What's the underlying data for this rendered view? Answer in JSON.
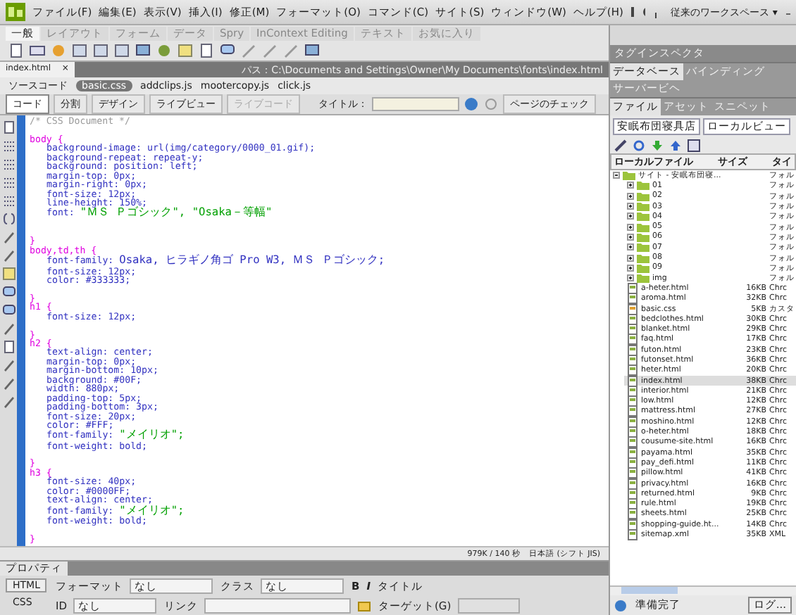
{
  "menu_bar": {
    "items": [
      "ファイル(F)",
      "編集(E)",
      "表示(V)",
      "挿入(I)",
      "修正(M)",
      "フォーマット(O)",
      "コマンド(C)",
      "サイト(S)",
      "ウィンドウ(W)",
      "ヘルプ(H)"
    ],
    "workspace": "従来のワークスペース",
    "workspace_caret": "▾"
  },
  "insert_bar": {
    "tabs": [
      {
        "label": "一般",
        "selected": true
      },
      {
        "label": "レイアウト",
        "selected": false
      },
      {
        "label": "フォーム",
        "selected": false
      },
      {
        "label": "データ",
        "selected": false
      },
      {
        "label": "Spry",
        "selected": false
      },
      {
        "label": "InContext Editing",
        "selected": false
      },
      {
        "label": "テキスト",
        "selected": false
      },
      {
        "label": "お気に入り",
        "selected": false
      }
    ]
  },
  "document_tab": {
    "label": "index.html",
    "close": "×",
    "path": "パス：C:\\Documents and Settings\\Owner\\My Documents\\fonts\\index.html"
  },
  "related_files": [
    {
      "label": "ソースコード",
      "selected": false
    },
    {
      "label": "basic.css",
      "selected": true
    },
    {
      "label": "addclips.js",
      "selected": false
    },
    {
      "label": "mootercopy.js",
      "selected": false
    },
    {
      "label": "click.js",
      "selected": false
    }
  ],
  "doc_toolbar": {
    "views": [
      {
        "label": "コード",
        "selected": true
      },
      {
        "label": "分割",
        "selected": false
      },
      {
        "label": "デザイン",
        "selected": false
      }
    ],
    "live_view": "ライブビュー",
    "live_code": "ライブコード",
    "title_label": "タイトル：",
    "check_page": "ページのチェック"
  },
  "code_lines": [
    {
      "kind": "comment",
      "text": "/* CSS Document */"
    },
    {
      "kind": "blank"
    },
    {
      "kind": "selector",
      "text": "body {"
    },
    {
      "kind": "decl",
      "prop": "background-image:",
      "value": "url(img/category/0000_01.gif);"
    },
    {
      "kind": "decl",
      "prop": "background-repeat:",
      "value": "repeat-y;"
    },
    {
      "kind": "decl",
      "prop": "background:",
      "value": "position: left;"
    },
    {
      "kind": "decl",
      "prop": "margin-top:",
      "value": "0px;"
    },
    {
      "kind": "decl",
      "prop": "margin-right:",
      "value": "0px;"
    },
    {
      "kind": "decl",
      "prop": "font-size:",
      "value": "12px;"
    },
    {
      "kind": "decl",
      "prop": "line-height:",
      "value": "150%;"
    },
    {
      "kind": "string",
      "prop": "font:",
      "value": "\"ＭＳ Ｐゴシック\", \"Osaka－等幅\""
    },
    {
      "kind": "blank"
    },
    {
      "kind": "blank"
    },
    {
      "kind": "selector",
      "text": "}"
    },
    {
      "kind": "selector",
      "text": "body,td,th {"
    },
    {
      "kind": "decl",
      "prop": "font-family:",
      "value": "Osaka, ヒラギノ角ゴ Pro W3, ＭＳ Ｐゴシック;"
    },
    {
      "kind": "decl",
      "prop": "font-size:",
      "value": "12px;"
    },
    {
      "kind": "decl",
      "prop": "color:",
      "value": "#333333;"
    },
    {
      "kind": "blank"
    },
    {
      "kind": "selector",
      "text": "}"
    },
    {
      "kind": "selector",
      "text": "h1 {"
    },
    {
      "kind": "decl",
      "prop": "font-size:",
      "value": "12px;"
    },
    {
      "kind": "blank"
    },
    {
      "kind": "selector",
      "text": "}"
    },
    {
      "kind": "selector",
      "text": "h2 {"
    },
    {
      "kind": "decl",
      "prop": "text-align:",
      "value": "center;"
    },
    {
      "kind": "decl",
      "prop": "margin-top:",
      "value": "0px;"
    },
    {
      "kind": "decl",
      "prop": "margin-bottom:",
      "value": "10px;"
    },
    {
      "kind": "decl",
      "prop": "background:",
      "value": "#00F;"
    },
    {
      "kind": "decl",
      "prop": "width:",
      "value": "880px;"
    },
    {
      "kind": "decl",
      "prop": "padding-top:",
      "value": "5px;"
    },
    {
      "kind": "decl",
      "prop": "padding-bottom:",
      "value": "3px;"
    },
    {
      "kind": "decl",
      "prop": "font-size:",
      "value": "20px;"
    },
    {
      "kind": "decl",
      "prop": "color:",
      "value": "#FFF;"
    },
    {
      "kind": "string",
      "prop": "font-family:",
      "value": "\"メイリオ\";"
    },
    {
      "kind": "decl",
      "prop": "font-weight:",
      "value": "bold;"
    },
    {
      "kind": "blank"
    },
    {
      "kind": "selector",
      "text": "}"
    },
    {
      "kind": "selector",
      "text": "h3 {"
    },
    {
      "kind": "decl",
      "prop": "font-size:",
      "value": "40px;"
    },
    {
      "kind": "decl",
      "prop": "color:",
      "value": "#0000FF;"
    },
    {
      "kind": "decl",
      "prop": "text-align:",
      "value": "center;"
    },
    {
      "kind": "string",
      "prop": "font-family:",
      "value": "\"メイリオ\";"
    },
    {
      "kind": "decl",
      "prop": "font-weight:",
      "value": "bold;"
    },
    {
      "kind": "blank"
    },
    {
      "kind": "selector",
      "text": "}"
    }
  ],
  "status_bar": {
    "size": "979K / 140 秒",
    "encoding": "日本語 (シフト JIS)"
  },
  "properties": {
    "title": "プロパティ",
    "modes": [
      {
        "label": "HTML",
        "selected": true
      },
      {
        "label": "CSS",
        "selected": false
      }
    ],
    "format_label": "フォーマット",
    "format": "なし",
    "class_label": "クラス",
    "class": "なし",
    "id_label": "ID",
    "id": "なし",
    "link_label": "リンク",
    "bold": "B",
    "italic": "I",
    "title_label": "タイトル",
    "target_label": "ターゲット(G)"
  },
  "panels": {
    "tag_inspector": "タグインスペクタ",
    "group_tabs": [
      {
        "label": "データベース",
        "selected": true
      },
      {
        "label": "バインディング",
        "selected": false
      },
      {
        "label": "サーバービヘ",
        "selected": false
      }
    ],
    "file_tabs": [
      {
        "label": "ファイル",
        "selected": true
      },
      {
        "label": "アセット",
        "selected": false
      },
      {
        "label": "スニペット",
        "selected": false
      }
    ],
    "site": "安眠布団寝具店",
    "view": "ローカルビュー",
    "columns": [
      "ローカルファイル",
      "サイズ",
      "タイ"
    ],
    "tree": [
      {
        "kind": "folder",
        "name": "サイト - 安眠布団寝...",
        "type": "フォル",
        "expanded": true,
        "children": [
          {
            "kind": "folder",
            "name": "01",
            "type": "フォル",
            "expanded": false
          },
          {
            "kind": "folder",
            "name": "02",
            "type": "フォル",
            "expanded": false
          },
          {
            "kind": "folder",
            "name": "03",
            "type": "フォル",
            "expanded": false
          },
          {
            "kind": "folder",
            "name": "04",
            "type": "フォル",
            "expanded": false
          },
          {
            "kind": "folder",
            "name": "05",
            "type": "フォル",
            "expanded": false
          },
          {
            "kind": "folder",
            "name": "06",
            "type": "フォル",
            "expanded": false
          },
          {
            "kind": "folder",
            "name": "07",
            "type": "フォル",
            "expanded": false
          },
          {
            "kind": "folder",
            "name": "08",
            "type": "フォル",
            "expanded": false
          },
          {
            "kind": "folder",
            "name": "09",
            "type": "フォル",
            "expanded": false
          },
          {
            "kind": "folder",
            "name": "img",
            "type": "フォル",
            "expanded": false
          },
          {
            "kind": "file",
            "name": "a-heter.html",
            "size": "16KB",
            "type": "Chrc",
            "selected": false
          },
          {
            "kind": "file",
            "name": "aroma.html",
            "size": "32KB",
            "type": "Chrc",
            "selected": false
          },
          {
            "kind": "css",
            "name": "basic.css",
            "size": "5KB",
            "type": "カスタ",
            "selected": false
          },
          {
            "kind": "file",
            "name": "bedclothes.html",
            "size": "30KB",
            "type": "Chrc",
            "selected": false
          },
          {
            "kind": "file",
            "name": "blanket.html",
            "size": "29KB",
            "type": "Chrc",
            "selected": false
          },
          {
            "kind": "file",
            "name": "faq.html",
            "size": "17KB",
            "type": "Chrc",
            "selected": false
          },
          {
            "kind": "file",
            "name": "futon.html",
            "size": "23KB",
            "type": "Chrc",
            "selected": false
          },
          {
            "kind": "file",
            "name": "futonset.html",
            "size": "36KB",
            "type": "Chrc",
            "selected": false
          },
          {
            "kind": "file",
            "name": "heter.html",
            "size": "20KB",
            "type": "Chrc",
            "selected": false
          },
          {
            "kind": "file",
            "name": "index.html",
            "size": "38KB",
            "type": "Chrc",
            "selected": true
          },
          {
            "kind": "file",
            "name": "interior.html",
            "size": "21KB",
            "type": "Chrc",
            "selected": false
          },
          {
            "kind": "file",
            "name": "low.html",
            "size": "12KB",
            "type": "Chrc",
            "selected": false
          },
          {
            "kind": "file",
            "name": "mattress.html",
            "size": "27KB",
            "type": "Chrc",
            "selected": false
          },
          {
            "kind": "file",
            "name": "moshino.html",
            "size": "12KB",
            "type": "Chrc",
            "selected": false
          },
          {
            "kind": "file",
            "name": "o-heter.html",
            "size": "18KB",
            "type": "Chrc",
            "selected": false
          },
          {
            "kind": "file",
            "name": "cousume-site.html",
            "size": "16KB",
            "type": "Chrc",
            "selected": false
          },
          {
            "kind": "file",
            "name": "payama.html",
            "size": "35KB",
            "type": "Chrc",
            "selected": false
          },
          {
            "kind": "file",
            "name": "pay_defi.html",
            "size": "11KB",
            "type": "Chrc",
            "selected": false
          },
          {
            "kind": "file",
            "name": "pillow.html",
            "size": "41KB",
            "type": "Chrc",
            "selected": false
          },
          {
            "kind": "file",
            "name": "privacy.html",
            "size": "16KB",
            "type": "Chrc",
            "selected": false
          },
          {
            "kind": "file",
            "name": "returned.html",
            "size": "9KB",
            "type": "Chrc",
            "selected": false
          },
          {
            "kind": "file",
            "name": "rule.html",
            "size": "19KB",
            "type": "Chrc",
            "selected": false
          },
          {
            "kind": "file",
            "name": "sheets.html",
            "size": "25KB",
            "type": "Chrc",
            "selected": false
          },
          {
            "kind": "file",
            "name": "shopping-guide.ht...",
            "size": "14KB",
            "type": "Chrc",
            "selected": false
          },
          {
            "kind": "file",
            "name": "sitemap.xml",
            "size": "35KB",
            "type": "XML",
            "selected": false
          }
        ]
      }
    ],
    "status": "準備完了",
    "log_button": "ログ..."
  }
}
